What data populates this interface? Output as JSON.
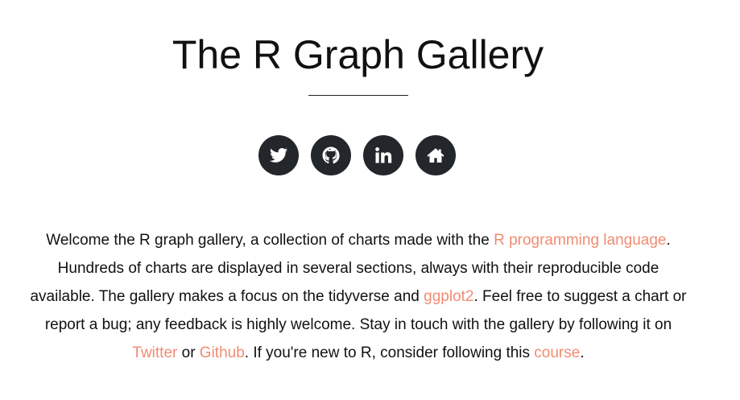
{
  "header": {
    "title": "The R Graph Gallery"
  },
  "social": [
    {
      "name": "twitter",
      "icon": "twitter-icon"
    },
    {
      "name": "github",
      "icon": "github-icon"
    },
    {
      "name": "linkedin",
      "icon": "linkedin-icon"
    },
    {
      "name": "home",
      "icon": "home-icon"
    }
  ],
  "intro": {
    "t1": "Welcome the R graph gallery, a collection of charts made with the ",
    "link_r": "R programming language",
    "t2": ". Hundreds of charts are displayed in several sections, always with their reproducible code available. The gallery makes a focus on the tidyverse and ",
    "link_ggplot": "ggplot2",
    "t3": ". Feel free to suggest a chart or report a bug; any feedback is highly welcome. Stay in touch with the gallery by following it on ",
    "link_twitter": "Twitter",
    "t4": " or ",
    "link_github": "Github",
    "t5": ". If you're new to R, consider following this ",
    "link_course": "course",
    "t6": "."
  },
  "colors": {
    "link": "#f08c73",
    "icon_bg": "#23272b",
    "text": "#111111"
  }
}
